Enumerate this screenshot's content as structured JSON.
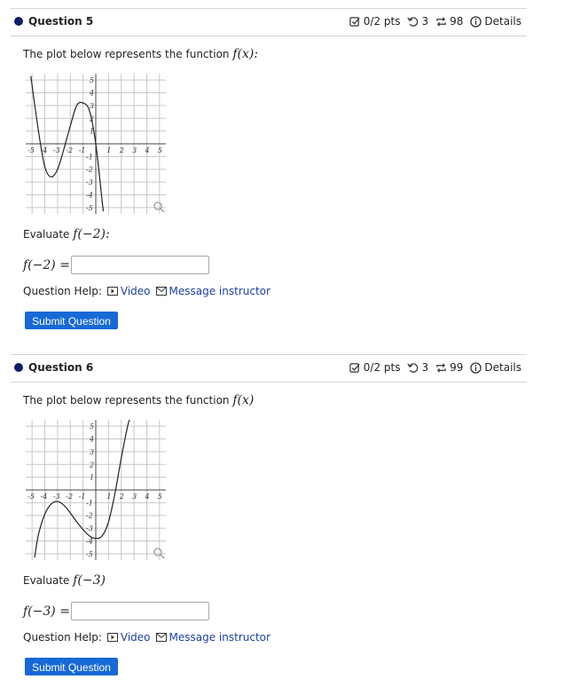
{
  "questions": [
    {
      "title": "Question 5",
      "score": "0/2 pts",
      "attempts": "3",
      "versions": "98",
      "details_label": "Details",
      "prompt_text": "The plot below represents the function",
      "prompt_fx": "f(x):",
      "evaluate_text": "Evaluate",
      "evaluate_expr": "f(−2):",
      "answer_label": "f(−2) =",
      "help_label": "Question Help:",
      "video_label": "Video",
      "message_label": "Message instructor",
      "submit_label": "Submit Question"
    },
    {
      "title": "Question 6",
      "score": "0/2 pts",
      "attempts": "3",
      "versions": "99",
      "details_label": "Details",
      "prompt_text": "The plot below represents the function",
      "prompt_fx": "f(x)",
      "evaluate_text": "Evaluate",
      "evaluate_expr": "f(−3)",
      "answer_label": "f(−3) =",
      "help_label": "Question Help:",
      "video_label": "Video",
      "message_label": "Message instructor",
      "submit_label": "Submit Question"
    }
  ],
  "chart_data": [
    {
      "type": "line",
      "xlim": [
        -5,
        5
      ],
      "ylim": [
        -5,
        5
      ],
      "grid": true,
      "x_ticks": [
        "-5",
        "-4",
        "-3",
        "-2",
        "-1",
        "1",
        "2",
        "3",
        "4",
        "5"
      ],
      "y_ticks": [
        "5",
        "4",
        "3",
        "2",
        "1",
        "-1",
        "-2",
        "-3",
        "-4",
        "-5"
      ],
      "series": [
        {
          "x": [
            -5.1,
            -4.5,
            -4,
            -3.5,
            -3,
            -2.5,
            -2,
            -1.5,
            -1,
            -0.5,
            0,
            0.5,
            0.6
          ],
          "y": [
            5.3,
            1,
            -1.8,
            -2.6,
            -2,
            -0.4,
            1.4,
            3,
            3.2,
            2.6,
            0,
            -4.5,
            -5.3
          ]
        }
      ]
    },
    {
      "type": "line",
      "xlim": [
        -5,
        5
      ],
      "ylim": [
        -5,
        5
      ],
      "grid": true,
      "x_ticks": [
        "-5",
        "-4",
        "-3",
        "-2",
        "-1",
        "1",
        "2",
        "3",
        "4",
        "5"
      ],
      "y_ticks": [
        "5",
        "4",
        "3",
        "2",
        "1",
        "-1",
        "-2",
        "-3",
        "-4",
        "-5"
      ],
      "series": [
        {
          "x": [
            -4.8,
            -4.5,
            -4,
            -3.5,
            -3,
            -2.5,
            -2,
            -1.5,
            -1,
            -0.5,
            0,
            0.5,
            1,
            1.5,
            2,
            2.5,
            2.7
          ],
          "y": [
            -5.3,
            -3.5,
            -1.9,
            -1.1,
            -0.9,
            -1.2,
            -1.8,
            -2.5,
            -3.1,
            -3.6,
            -3.8,
            -3.6,
            -2.5,
            -0.3,
            2.5,
            5,
            5.6
          ]
        }
      ]
    }
  ]
}
